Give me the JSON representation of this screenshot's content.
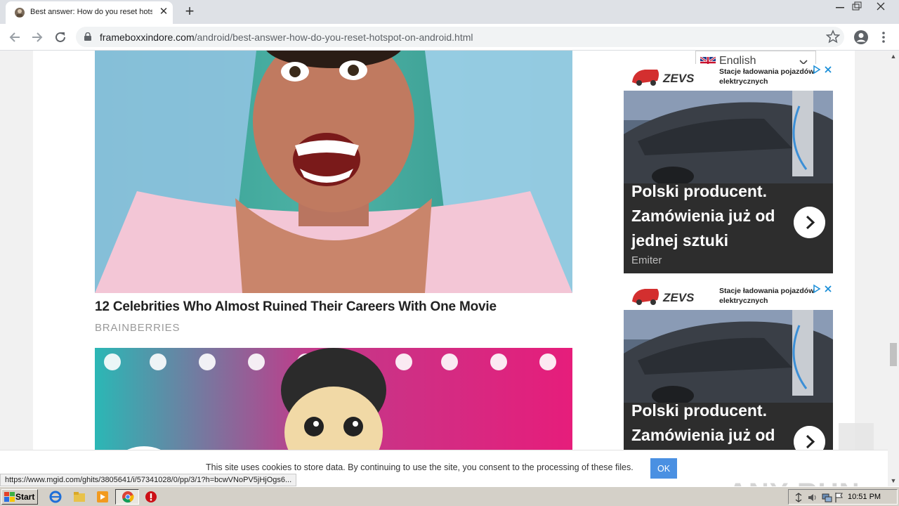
{
  "browser": {
    "tab_title": "Best answer: How do you reset hotspot on android",
    "url_host": "frameboxxindore.com",
    "url_path": "/android/best-answer-how-do-you-reset-hotspot-on-android.html"
  },
  "translate": {
    "language": "English"
  },
  "article": {
    "title": "12 Celebrities Who Almost Ruined Their Careers With One Movie",
    "source": "BRAINBERRIES"
  },
  "ads": [
    {
      "brand": "ZEVS",
      "tagline": "Stacje ładowania pojazdów elektrycznych",
      "headline": "Polski producent. Zamówienia już od jednej sztuki",
      "sponsor": "Emiter"
    },
    {
      "brand": "ZEVS",
      "tagline": "Stacje ładowania pojazdów elektrycznych",
      "headline": "Polski producent. Zamówienia już od",
      "sponsor": ""
    }
  ],
  "cookie": {
    "text": "This site uses cookies to store data. By continuing to use the site, you consent to the processing of these files.",
    "ok_label": "OK"
  },
  "status_bar": {
    "link": "https://www.mgid.com/ghits/3805641/i/57341028/0/pp/3/1?h=bcwVNoPV5jHjOgs6..."
  },
  "watermark": "ANY RUN",
  "taskbar": {
    "start_label": "Start",
    "clock": "10:51 PM"
  },
  "colors": {
    "accent_button": "#4a90e2",
    "ad_background": "#2d2d2d",
    "ad_logo_red": "#d32f2f"
  }
}
